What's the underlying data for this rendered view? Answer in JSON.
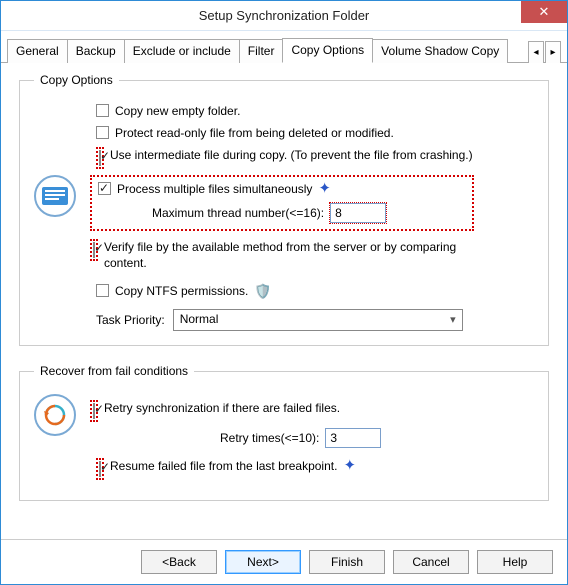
{
  "window": {
    "title": "Setup Synchronization Folder"
  },
  "tabs": {
    "items": [
      "General",
      "Backup",
      "Exclude or include",
      "Filter",
      "Copy Options",
      "Volume Shadow Copy"
    ],
    "active": 4
  },
  "groups": {
    "copy": {
      "legend": "Copy Options"
    },
    "recover": {
      "legend": "Recover from fail conditions"
    }
  },
  "copy": {
    "new_empty": {
      "label": "Copy new empty folder.",
      "checked": false
    },
    "protect_ro": {
      "label": "Protect read-only file from being deleted or modified.",
      "checked": false
    },
    "intermediate": {
      "label": "Use intermediate file during copy. (To prevent the file from crashing.)",
      "checked": true
    },
    "multithread": {
      "label": "Process multiple files simultaneously",
      "checked": true,
      "max_label": "Maximum thread number(<=16):",
      "max_value": "8"
    },
    "verify": {
      "label": "Verify file by the available method from the server or by comparing content.",
      "checked": true
    },
    "ntfs": {
      "label": "Copy NTFS permissions.",
      "checked": false
    },
    "priority": {
      "label": "Task Priority:",
      "value": "Normal"
    }
  },
  "recover": {
    "retry": {
      "label": "Retry synchronization if there are failed files.",
      "checked": true,
      "times_label": "Retry times(<=10):",
      "times_value": "3"
    },
    "resume": {
      "label": "Resume failed file from the last breakpoint.",
      "checked": true
    }
  },
  "buttons": {
    "back": "<Back",
    "next": "Next>",
    "finish": "Finish",
    "cancel": "Cancel",
    "help": "Help"
  }
}
